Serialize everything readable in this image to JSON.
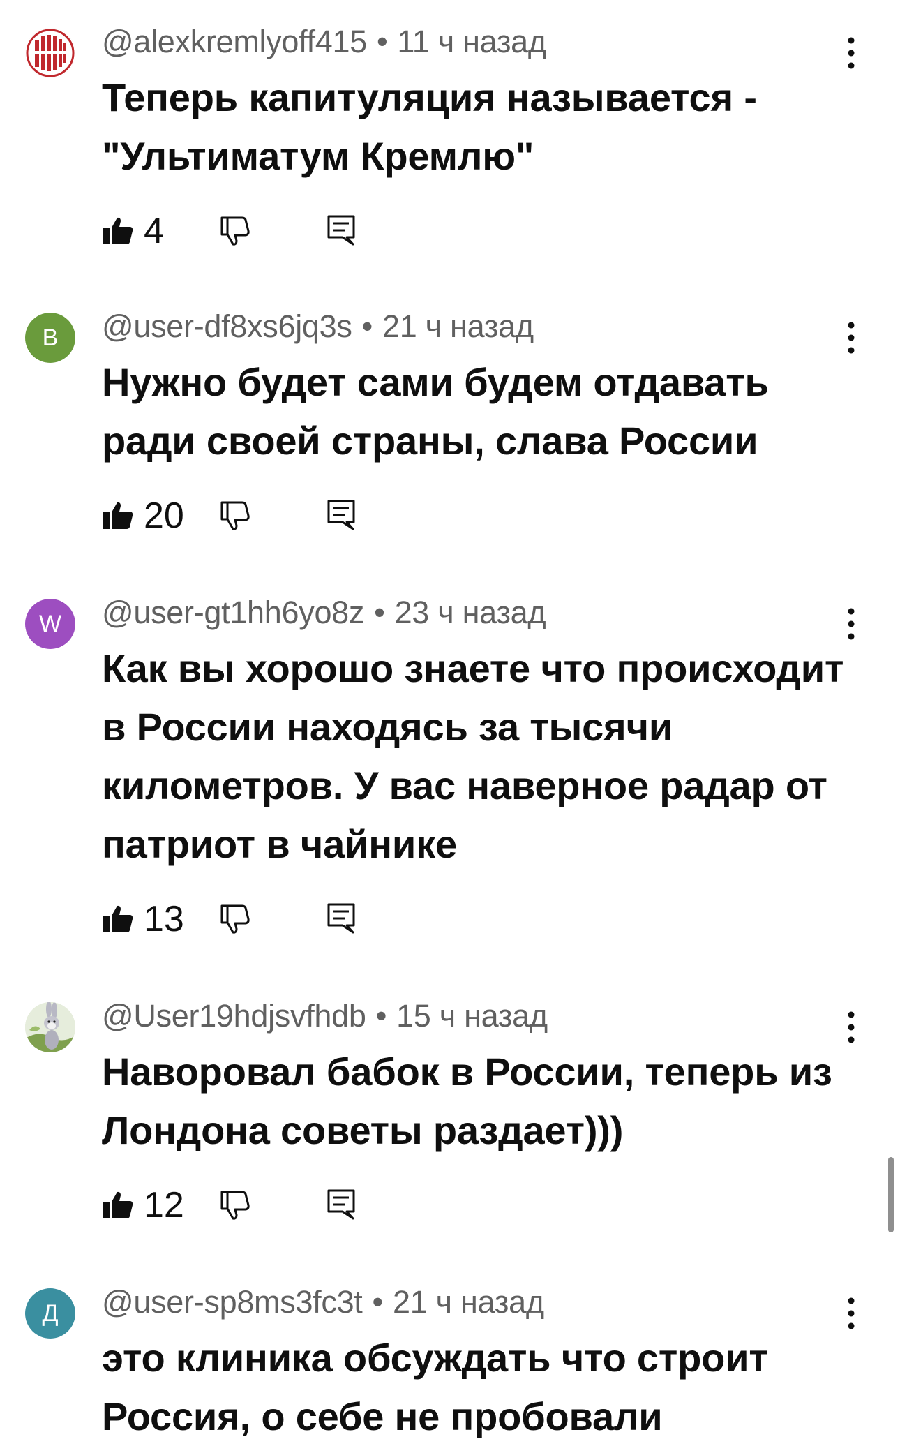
{
  "comments": [
    {
      "author": "@alexkremlyoff415",
      "time": "11 ч назад",
      "text": "Теперь капитуляция называется - \"Ультиматум Кремлю\"",
      "likes": "4",
      "avatar": {
        "type": "image",
        "color": "#c0282d"
      }
    },
    {
      "author": "@user-df8xs6jq3s",
      "time": "21 ч назад",
      "text": "Нужно будет сами будем отдавать ради своей страны, слава России",
      "likes": "20",
      "avatar": {
        "type": "letter",
        "letter": "В",
        "color": "#6a9b3c"
      }
    },
    {
      "author": "@user-gt1hh6yo8z",
      "time": "23 ч назад",
      "text": "Как вы хорошо знаете что происходит в России находясь за тысячи километров. У вас наверное радар от патриот в чайнике",
      "likes": "13",
      "avatar": {
        "type": "letter",
        "letter": "W",
        "color": "#9d4ec0"
      }
    },
    {
      "author": "@User19hdjsvfhdb",
      "time": "15 ч назад",
      "text": "Наворовал бабок в России, теперь из Лондона советы раздает)))",
      "likes": "12",
      "avatar": {
        "type": "image",
        "color": "#9bb37a"
      }
    },
    {
      "author": "@user-sp8ms3fc3t",
      "time": "21 ч назад",
      "text": "это клиника обсуждать что строит Россия, о себе не пробовали",
      "likes": "",
      "avatar": {
        "type": "letter",
        "letter": "Д",
        "color": "#3a8fa0"
      }
    }
  ],
  "icons": {
    "like": "thumbs-up-filled-icon",
    "dislike": "thumbs-down-outline-icon",
    "reply": "reply-comment-icon",
    "more": "more-vertical-icon"
  },
  "meta_separator": "•"
}
